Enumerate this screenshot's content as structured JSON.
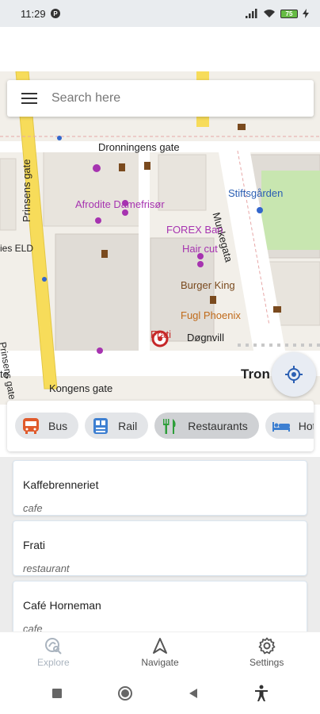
{
  "status_bar": {
    "time": "11:29",
    "battery_level": "75",
    "icons": [
      "p-icon",
      "signal-icon",
      "wifi-icon",
      "battery-icon",
      "charging-icon"
    ]
  },
  "search": {
    "placeholder": "Search here"
  },
  "map": {
    "street_labels": {
      "dronningens": "Dronningens gate",
      "prinsens_top": "Prinsens gate",
      "prinsens_bottom": "Prinsens gate",
      "munkegata": "Munkegata",
      "kongens": "Kongens gate",
      "ies_eld": "ies ELD",
      "te": "te"
    },
    "poi_labels": {
      "afrodite": "Afrodite Damefrisør",
      "forex": "FOREX Ban",
      "hair_cut": "Hair cut",
      "burger_king": "Burger King",
      "fugl_phoenix": "Fugl Phoenix",
      "dognvill": "Døgnvill",
      "frati": "Frati",
      "stiftsgarden": "Stiftsgården",
      "tron": "Tron"
    },
    "colors": {
      "road": "#ffffff",
      "main_road": "#f7dc5a",
      "park": "#c8e6b0",
      "building": "#e0dcd6",
      "shop_poi": "#a633b0",
      "food_poi": "#7a4a1e",
      "blue_poi": "#3366cc"
    }
  },
  "categories": [
    {
      "label": "Bus",
      "icon": "bus-icon",
      "color": "#e05a2b"
    },
    {
      "label": "Rail",
      "icon": "rail-icon",
      "color": "#3d7fd1"
    },
    {
      "label": "Restaurants",
      "icon": "fork-knife-icon",
      "color": "#2e9e3a"
    },
    {
      "label": "Hotel",
      "icon": "bed-icon",
      "color": "#3d7fd1"
    }
  ],
  "selected_category": "Restaurants",
  "results": [
    {
      "name": "Kaffebrenneriet",
      "type": "cafe"
    },
    {
      "name": "Frati",
      "type": "restaurant"
    },
    {
      "name": "Café Horneman",
      "type": "cafe"
    }
  ],
  "bottom_nav": [
    {
      "label": "Explore",
      "icon": "explore-icon"
    },
    {
      "label": "Navigate",
      "icon": "navigate-icon"
    },
    {
      "label": "Settings",
      "icon": "gear-icon"
    }
  ],
  "active_nav": "Explore"
}
